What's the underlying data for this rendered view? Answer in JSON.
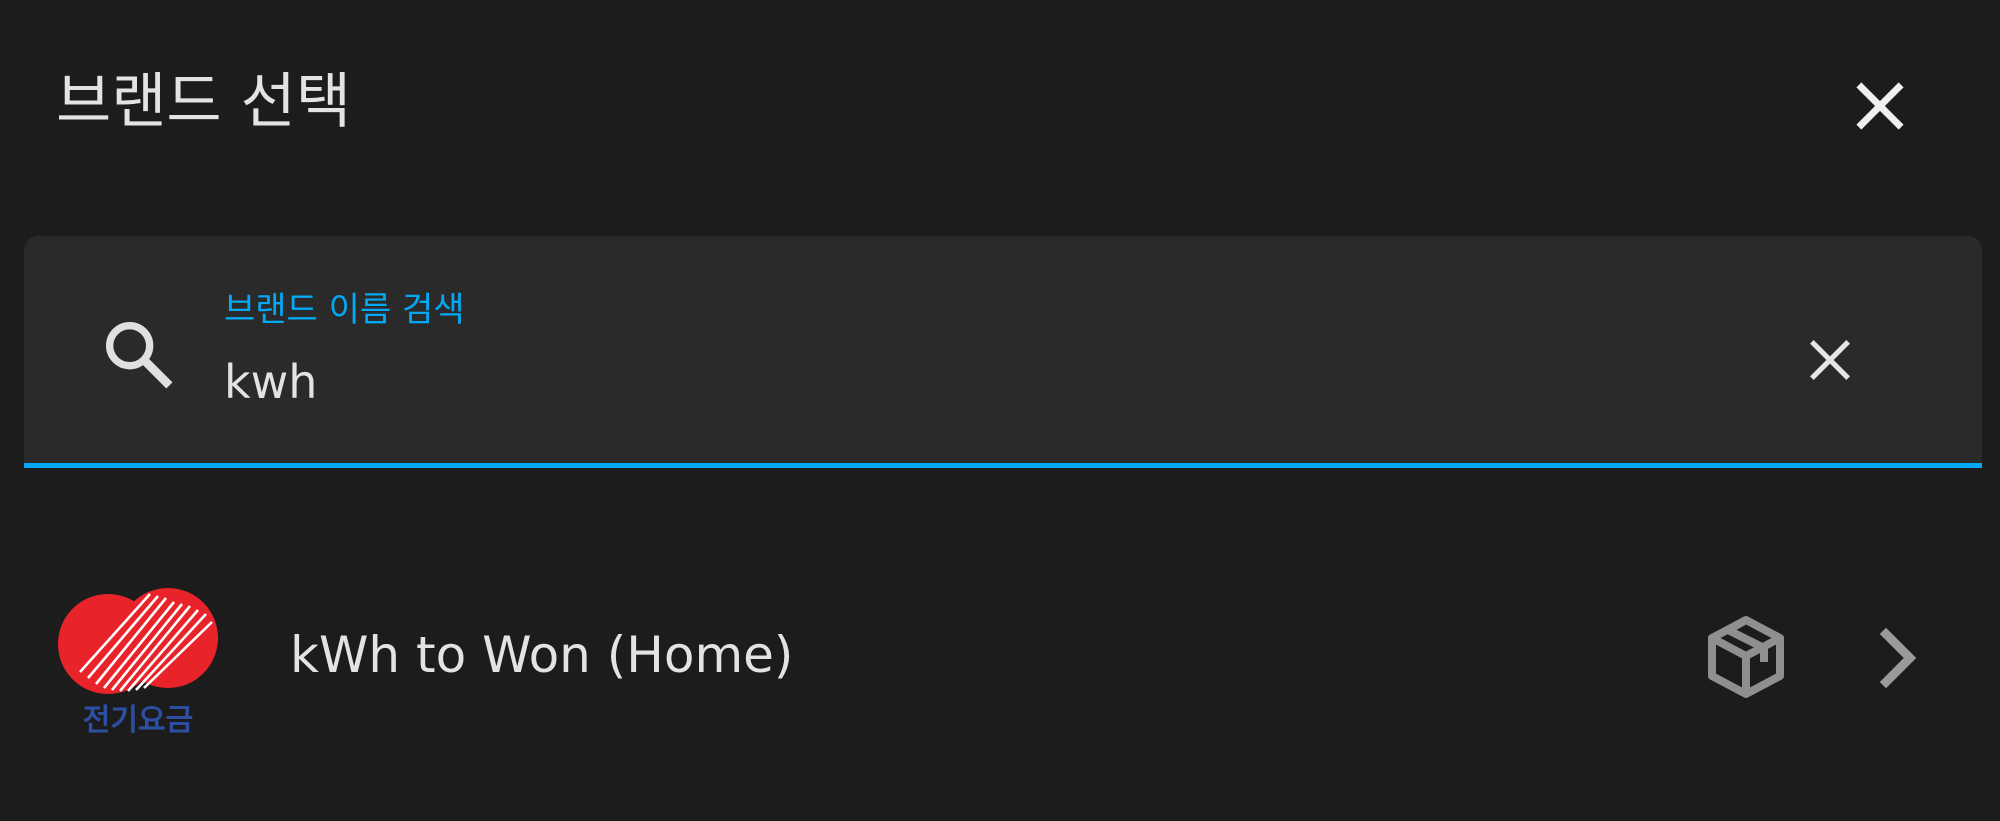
{
  "dialog": {
    "title": "브랜드 선택"
  },
  "search": {
    "label": "브랜드 이름 검색",
    "value": "kwh"
  },
  "results": [
    {
      "label": "kWh to Won (Home)",
      "logo_text": "전기요금",
      "icons": [
        "custom-integration-box-icon",
        "chevron-right-icon"
      ]
    }
  ],
  "colors": {
    "background": "#1c1c1c",
    "search_background": "#2a2a2a",
    "accent": "#03a9f4",
    "text": "#e3e3e3",
    "logo_red": "#e8232a",
    "logo_blue": "#2d4fa3"
  }
}
